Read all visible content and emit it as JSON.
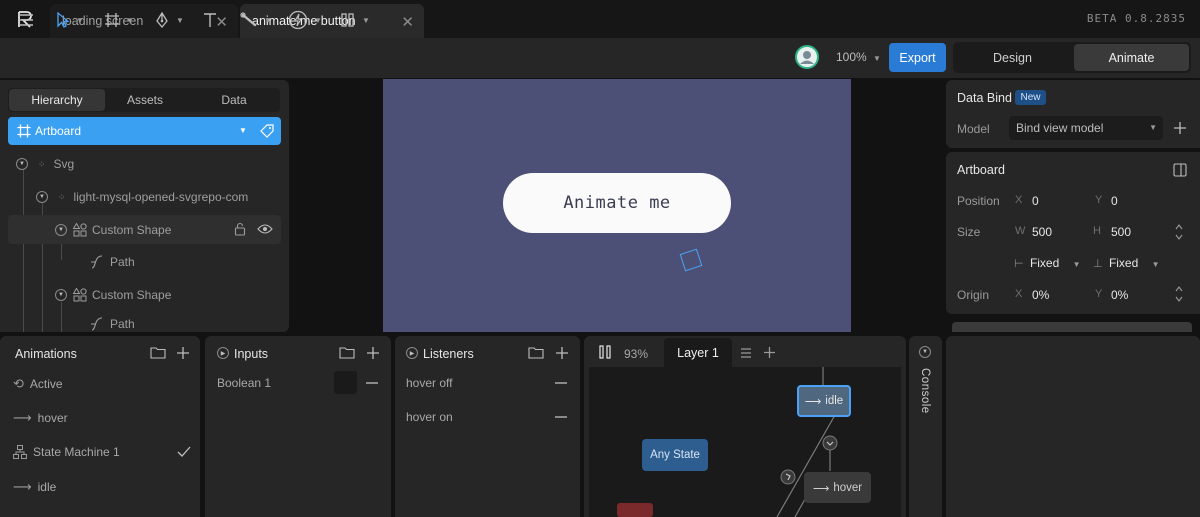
{
  "titlebar": {
    "tabs": [
      {
        "label": "loading screen",
        "active": false
      },
      {
        "label": "animate me button",
        "active": true
      }
    ],
    "version": "BETA 0.8.2835"
  },
  "toolbar": {
    "zoom": "100%",
    "export_label": "Export",
    "modes": {
      "design": "Design",
      "animate": "Animate",
      "active": "animate"
    },
    "accent": "#2a7bd5"
  },
  "left_panel": {
    "tabs": [
      "Hierarchy",
      "Assets",
      "Data"
    ],
    "active_tab": "Hierarchy",
    "artboard_label": "Artboard",
    "tree": {
      "svg": "Svg",
      "group": "light-mysql-opened-svgrepo-com",
      "shape1": "Custom Shape",
      "path1": "Path",
      "shape2": "Custom Shape",
      "path2": "Path"
    }
  },
  "canvas": {
    "button_text": "Animate me",
    "artboard_color": "#4d5076"
  },
  "right_panel": {
    "data_bind": {
      "title": "Data Bind",
      "badge": "New",
      "model_label": "Model",
      "model_value": "Bind view model"
    },
    "artboard": {
      "title": "Artboard",
      "position_label": "Position",
      "x_axis": "X",
      "y_axis": "Y",
      "x": "0",
      "y": "0",
      "size_label": "Size",
      "w_axis": "W",
      "h_axis": "H",
      "w": "500",
      "h": "500",
      "w_mode": "Fixed",
      "h_mode": "Fixed",
      "origin_label": "Origin",
      "origin_x": "0%",
      "origin_y": "0%"
    }
  },
  "animations": {
    "title": "Animations",
    "items": [
      "Active",
      "hover",
      "State Machine 1",
      "idle"
    ]
  },
  "inputs": {
    "title": "Inputs",
    "items": [
      "Boolean 1"
    ]
  },
  "listeners": {
    "title": "Listeners",
    "items": [
      "hover off",
      "hover on"
    ]
  },
  "state_machine": {
    "zoom": "93%",
    "layer_tab": "Layer 1",
    "states": {
      "idle": "idle",
      "any": "Any State",
      "hover": "hover"
    }
  },
  "console": {
    "label": "Console"
  }
}
